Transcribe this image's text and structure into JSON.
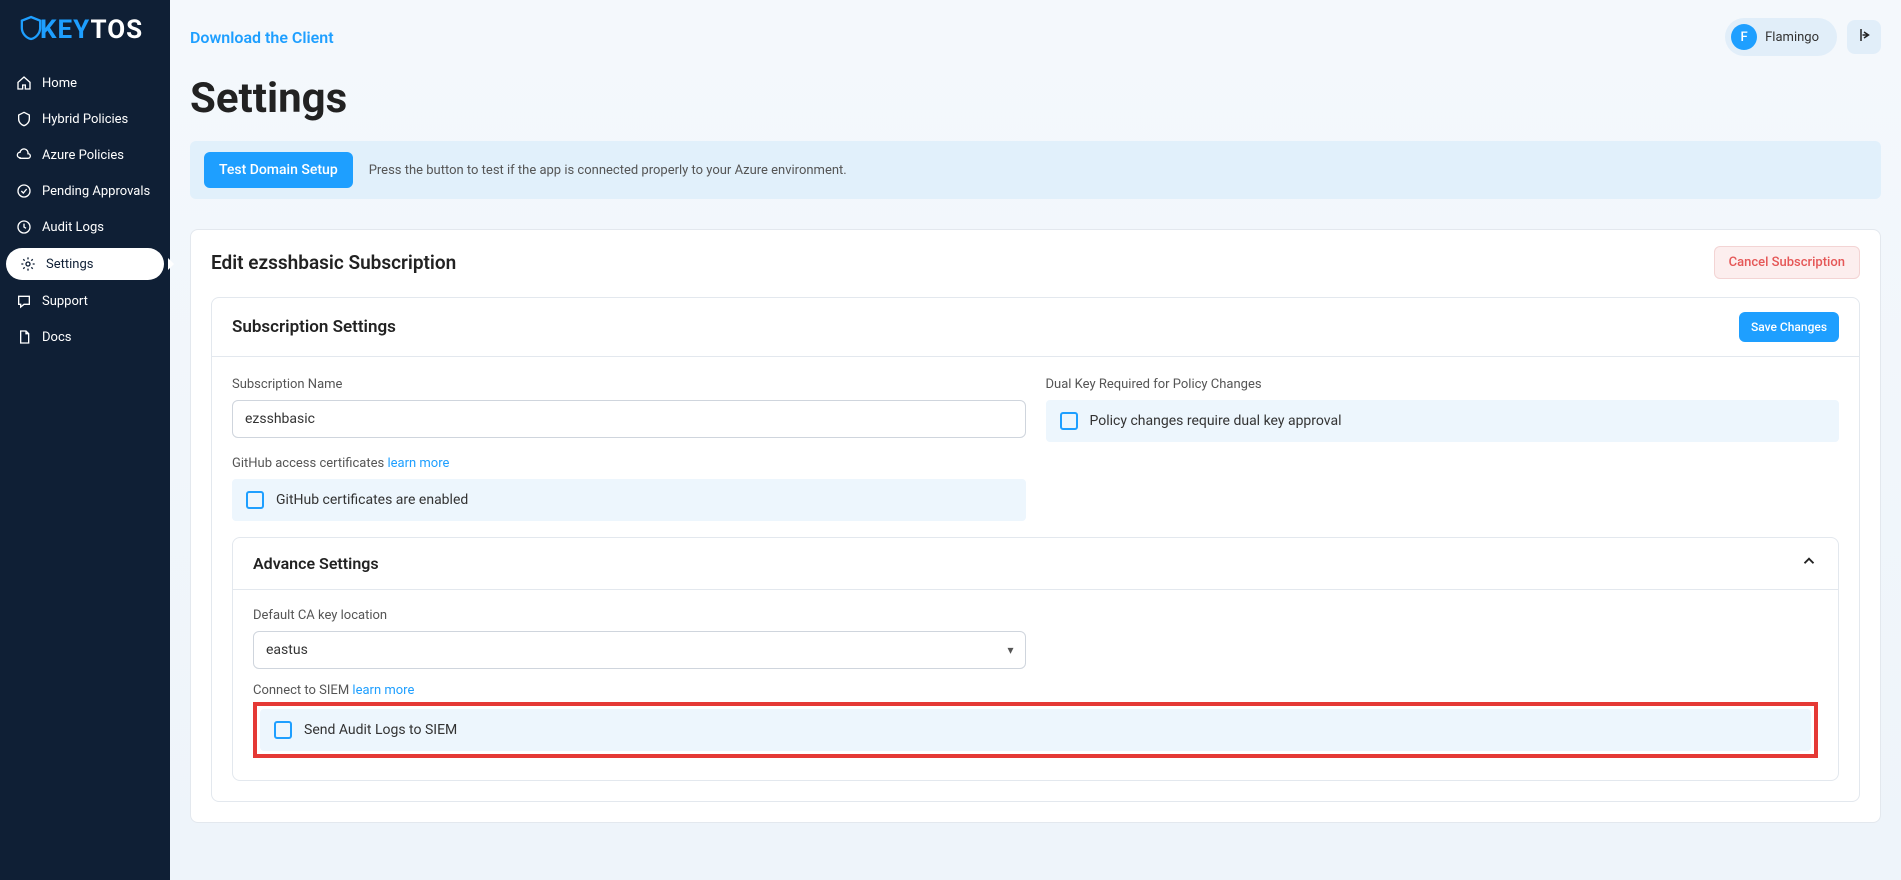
{
  "brand": {
    "pre": "KEY",
    "post": "TOS"
  },
  "topbar": {
    "download_label": "Download the Client",
    "user_initial": "F",
    "user_name": "Flamingo"
  },
  "sidebar": {
    "items": [
      {
        "label": "Home"
      },
      {
        "label": "Hybrid Policies"
      },
      {
        "label": "Azure Policies"
      },
      {
        "label": "Pending Approvals"
      },
      {
        "label": "Audit Logs"
      },
      {
        "label": "Settings"
      },
      {
        "label": "Support"
      },
      {
        "label": "Docs"
      }
    ]
  },
  "page": {
    "title": "Settings"
  },
  "alert": {
    "button_label": "Test Domain Setup",
    "text": "Press the button to test if the app is connected properly to your Azure environment."
  },
  "subscription": {
    "header": "Edit ezsshbasic Subscription",
    "cancel_label": "Cancel Subscription",
    "settings_header": "Subscription Settings",
    "save_label": "Save Changes",
    "name_label": "Subscription Name",
    "name_value": "ezsshbasic",
    "dualkey_label": "Dual Key Required for Policy Changes",
    "dualkey_text": "Policy changes require dual key approval",
    "github_label": "GitHub access certificates ",
    "github_link": "learn more",
    "github_text": "GitHub certificates are enabled"
  },
  "advance": {
    "header": "Advance Settings",
    "ca_label": "Default CA key location",
    "ca_value": "eastus",
    "siem_label": "Connect to SIEM ",
    "siem_link": "learn more",
    "siem_text": "Send Audit Logs to SIEM"
  }
}
